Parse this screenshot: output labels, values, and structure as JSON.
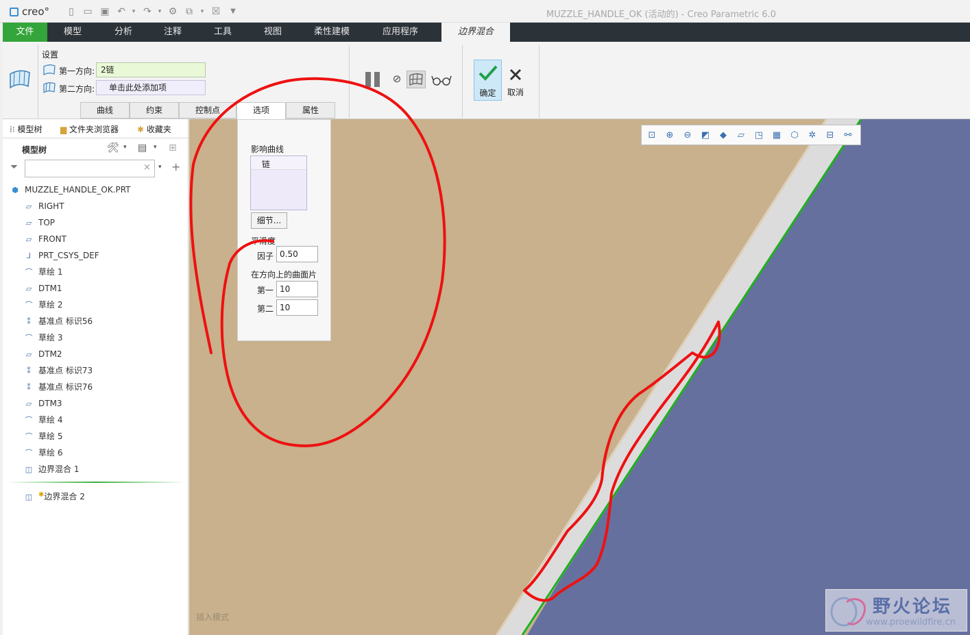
{
  "titlebar": {
    "logo": "creo°",
    "window_title": "MUZZLE_HANDLE_OK (活动的) - Creo Parametric 6.0"
  },
  "ribbon_tabs": [
    "文件",
    "模型",
    "分析",
    "注释",
    "工具",
    "视图",
    "柔性建模",
    "应用程序",
    "边界混合"
  ],
  "settings": {
    "group_label": "设置",
    "dir1_label": "第一方向:",
    "dir1_value": "2链",
    "dir2_label": "第二方向:",
    "dir2_placeholder": "单击此处添加项"
  },
  "subtabs": [
    "曲线",
    "约束",
    "控制点",
    "选项",
    "属性"
  ],
  "actions": {
    "ok_label": "确定",
    "cancel_label": "取消"
  },
  "left_tabs": {
    "model_tree": "模型树",
    "folder_browser": "文件夹浏览器",
    "favorites": "收藏夹"
  },
  "model_tree": {
    "header": "模型树",
    "root": "MUZZLE_HANDLE_OK.PRT",
    "items": [
      {
        "label": "RIGHT",
        "icon": "datum-plane-icon"
      },
      {
        "label": "TOP",
        "icon": "datum-plane-icon"
      },
      {
        "label": "FRONT",
        "icon": "datum-plane-icon"
      },
      {
        "label": "PRT_CSYS_DEF",
        "icon": "csys-icon"
      },
      {
        "label": "草绘 1",
        "icon": "sketch-icon"
      },
      {
        "label": "DTM1",
        "icon": "datum-plane-icon"
      },
      {
        "label": "草绘 2",
        "icon": "sketch-icon"
      },
      {
        "label": "基准点 标识56",
        "icon": "datum-point-icon"
      },
      {
        "label": "草绘 3",
        "icon": "sketch-icon"
      },
      {
        "label": "DTM2",
        "icon": "datum-plane-icon"
      },
      {
        "label": "基准点 标识73",
        "icon": "datum-point-icon"
      },
      {
        "label": "基准点 标识76",
        "icon": "datum-point-icon"
      },
      {
        "label": "DTM3",
        "icon": "datum-plane-icon"
      },
      {
        "label": "草绘 4",
        "icon": "sketch-icon"
      },
      {
        "label": "草绘 5",
        "icon": "sketch-icon"
      },
      {
        "label": "草绘 6",
        "icon": "sketch-icon"
      },
      {
        "label": "边界混合 1",
        "icon": "boundary-blend-icon"
      }
    ],
    "active_feature": "边界混合 2"
  },
  "options_panel": {
    "influence_curves_label": "影响曲线",
    "chain_item": "链",
    "details_button": "细节...",
    "smoothness_label": "平滑度",
    "factor_label": "因子",
    "factor_value": "0.50",
    "patches_label": "在方向上的曲面片",
    "first_label": "第一",
    "first_value": "10",
    "second_label": "第二",
    "second_value": "10"
  },
  "status_text": "插入模式",
  "watermark": {
    "title": "野火论坛",
    "url": "www.proewildfire.cn"
  },
  "colors": {
    "file_tab": "#34a53a",
    "surface_tan": "#c8b18c",
    "surface_blue": "#66709f",
    "edge_green": "#1eb01e",
    "annotation_red": "#ee1111"
  }
}
